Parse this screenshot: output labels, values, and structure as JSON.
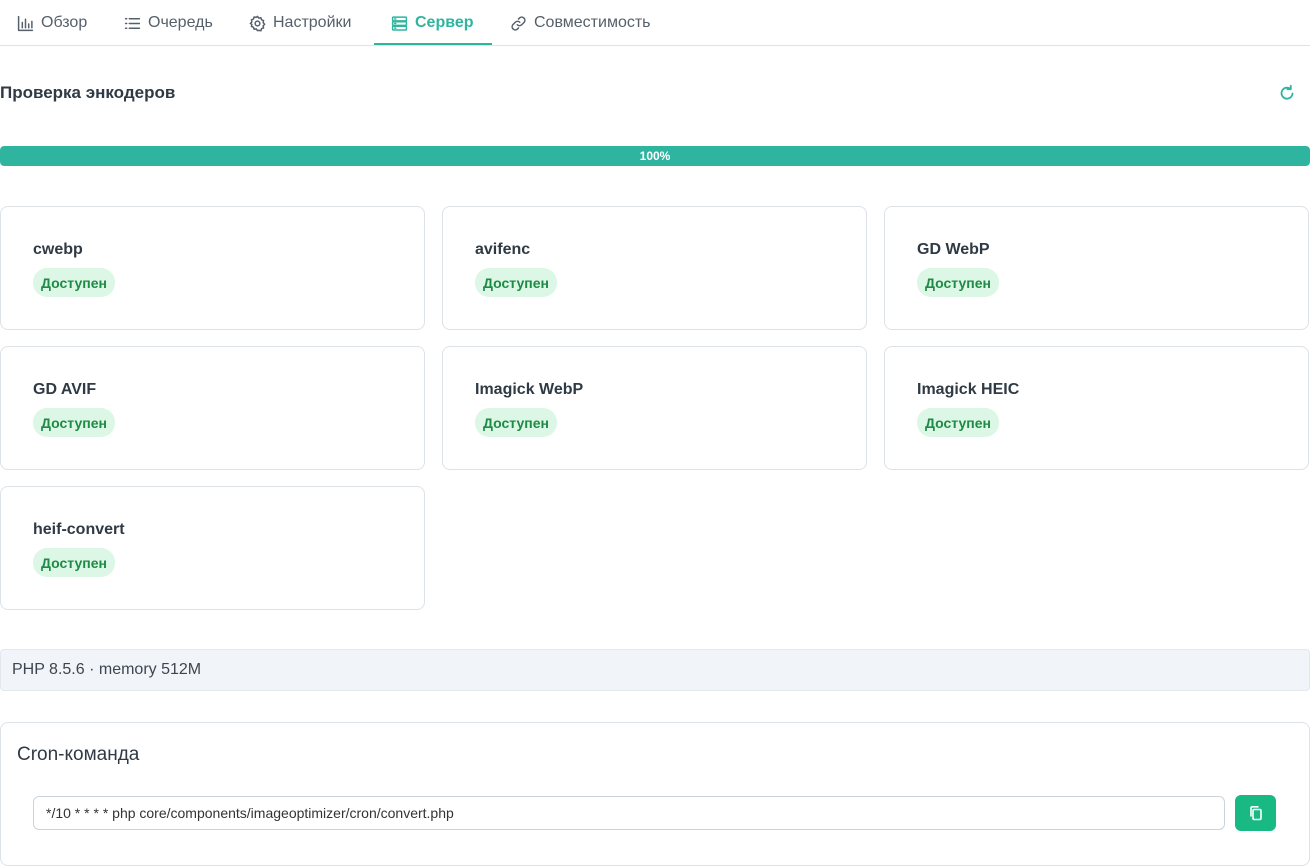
{
  "tabs": [
    {
      "label": "Обзор",
      "icon": "bar-chart-icon"
    },
    {
      "label": "Очередь",
      "icon": "list-icon"
    },
    {
      "label": "Настройки",
      "icon": "gear-icon"
    },
    {
      "label": "Сервер",
      "icon": "server-icon",
      "active": true
    },
    {
      "label": "Совместимость",
      "icon": "link-icon"
    }
  ],
  "section": {
    "title": "Проверка энкодеров",
    "refresh_icon": "refresh-icon"
  },
  "progress": {
    "value": 100,
    "label": "100%",
    "color": "#2fb59f"
  },
  "encoders": [
    {
      "name": "cwebp",
      "status": "Доступен"
    },
    {
      "name": "avifenc",
      "status": "Доступен"
    },
    {
      "name": "GD WebP",
      "status": "Доступен"
    },
    {
      "name": "GD AVIF",
      "status": "Доступен"
    },
    {
      "name": "Imagick WebP",
      "status": "Доступен"
    },
    {
      "name": "Imagick HEIC",
      "status": "Доступен"
    },
    {
      "name": "heif-convert",
      "status": "Доступен"
    }
  ],
  "php_info": "PHP 8.5.6 · memory 512M",
  "cron": {
    "title": "Cron-команда",
    "command": "*/10 * * * * php core/components/imageoptimizer/cron/convert.php",
    "copy_icon": "copy-icon"
  },
  "colors": {
    "accent": "#2fb59f",
    "badge_bg": "#dcf7e6",
    "badge_text": "#1f8a45",
    "copy_button": "#19b984"
  }
}
